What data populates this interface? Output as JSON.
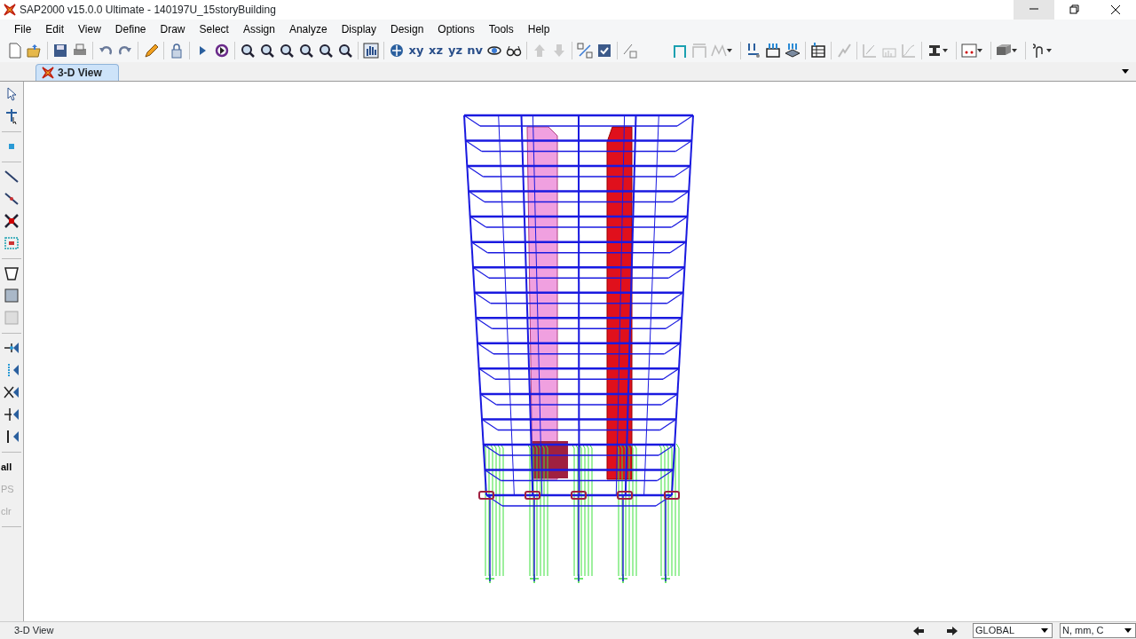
{
  "window": {
    "title": "SAP2000 v15.0.0 Ultimate  - 140197U_15storyBuilding"
  },
  "menu": [
    "File",
    "Edit",
    "View",
    "Define",
    "Draw",
    "Select",
    "Assign",
    "Analyze",
    "Display",
    "Design",
    "Options",
    "Tools",
    "Help"
  ],
  "view_buttons": [
    "xy",
    "xz",
    "yz",
    "nv"
  ],
  "tabs": [
    {
      "label": "3-D View",
      "selected": true
    }
  ],
  "select_buttons": [
    {
      "label": "all",
      "disabled": false
    },
    {
      "label": "PS",
      "disabled": true
    },
    {
      "label": "clr",
      "disabled": true
    }
  ],
  "status_bar": {
    "text": "3-D View",
    "coordinate_system": "GLOBAL",
    "units": "N, mm, C"
  }
}
